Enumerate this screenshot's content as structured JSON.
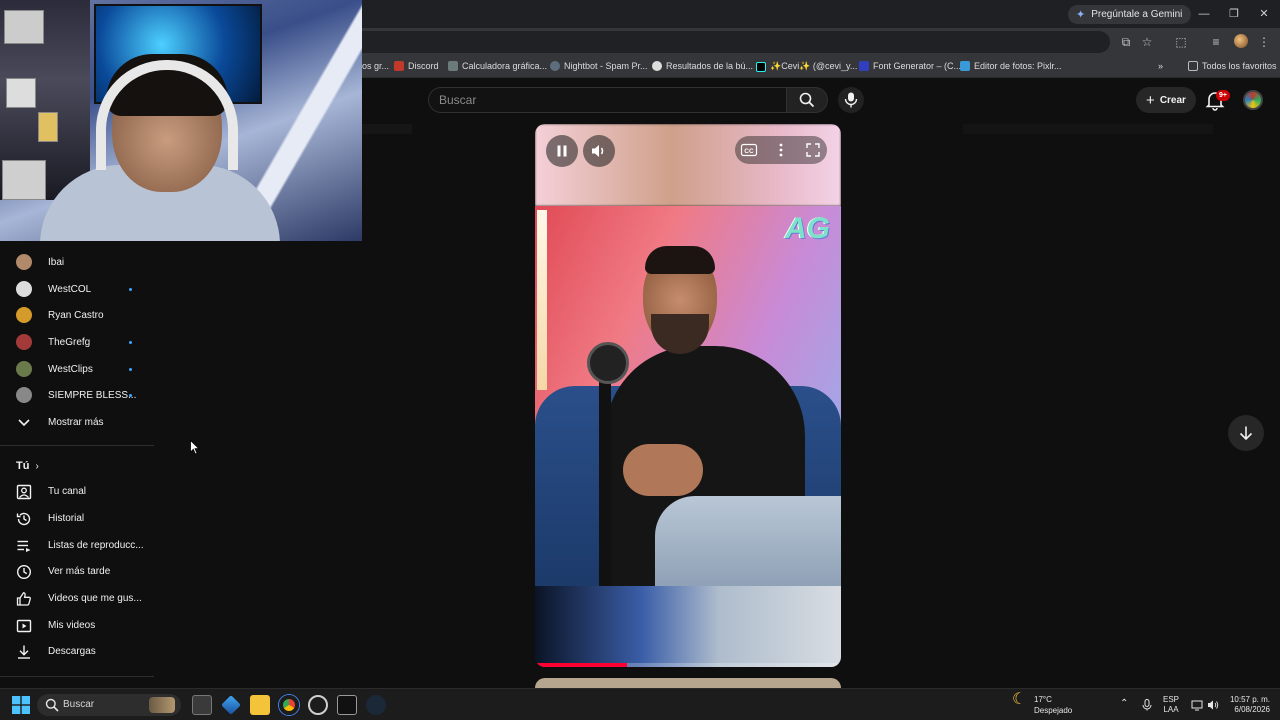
{
  "browser": {
    "gemini_label": "Pregúntale a Gemini",
    "window_controls": [
      "—",
      "❐",
      "✕"
    ]
  },
  "bookmarks": {
    "items": [
      {
        "label": "os gr...",
        "color": "#555555"
      },
      {
        "label": "Discord",
        "color": "#c0392b"
      },
      {
        "label": "Calculadora gráfica...",
        "color": "#7f8c8d"
      },
      {
        "label": "Nightbot - Spam Pr...",
        "color": "#5d6d7e"
      },
      {
        "label": "Resultados de la bú...",
        "color": "#dddddd"
      },
      {
        "label": "✨Cevi✨ (@cevi_y...",
        "color": "#111111"
      },
      {
        "label": "Font Generator – (C...",
        "color": "#2f3fbf"
      },
      {
        "label": "Editor de fotos: Pixlr...",
        "color": "#3a9ad9"
      }
    ],
    "more": "»",
    "all_label": "Todos los favoritos"
  },
  "header": {
    "search_placeholder": "Buscar",
    "create_label": "Crear",
    "notification_count": "9+"
  },
  "sidebar": {
    "subscriptions": [
      {
        "label": "Ibai",
        "color": "#b08a6a",
        "live_dot": false
      },
      {
        "label": "WestCOL",
        "color": "#dcdcdc",
        "live_dot": true
      },
      {
        "label": "Ryan Castro",
        "color": "#d49a2a",
        "live_dot": false
      },
      {
        "label": "TheGrefg",
        "color": "#a33a3a",
        "live_dot": true
      },
      {
        "label": "WestClips",
        "color": "#6b7a4a",
        "live_dot": true
      },
      {
        "label": "SIEMPRE BLESS...",
        "color": "#888888",
        "live_dot": true
      }
    ],
    "show_more": "Mostrar más",
    "you_section": "Tú",
    "you_items": [
      {
        "label": "Tu canal",
        "icon": "channel-icon"
      },
      {
        "label": "Historial",
        "icon": "history-icon"
      },
      {
        "label": "Listas de reproducc...",
        "icon": "playlists-icon"
      },
      {
        "label": "Ver más tarde",
        "icon": "watch-later-icon"
      },
      {
        "label": "Videos que me gus...",
        "icon": "liked-icon"
      },
      {
        "label": "Mis videos",
        "icon": "my-videos-icon"
      },
      {
        "label": "Descargas",
        "icon": "downloads-icon"
      }
    ]
  },
  "player": {
    "progress": 0.3,
    "logo_text": "AG"
  },
  "taskbar": {
    "search_label": "Buscar",
    "weather_temp": "17°C",
    "weather_desc": "Despejado",
    "lang_1": "ESP",
    "lang_2": "LAA",
    "time": "10:57 p. m.",
    "date": "6/08/2026"
  }
}
